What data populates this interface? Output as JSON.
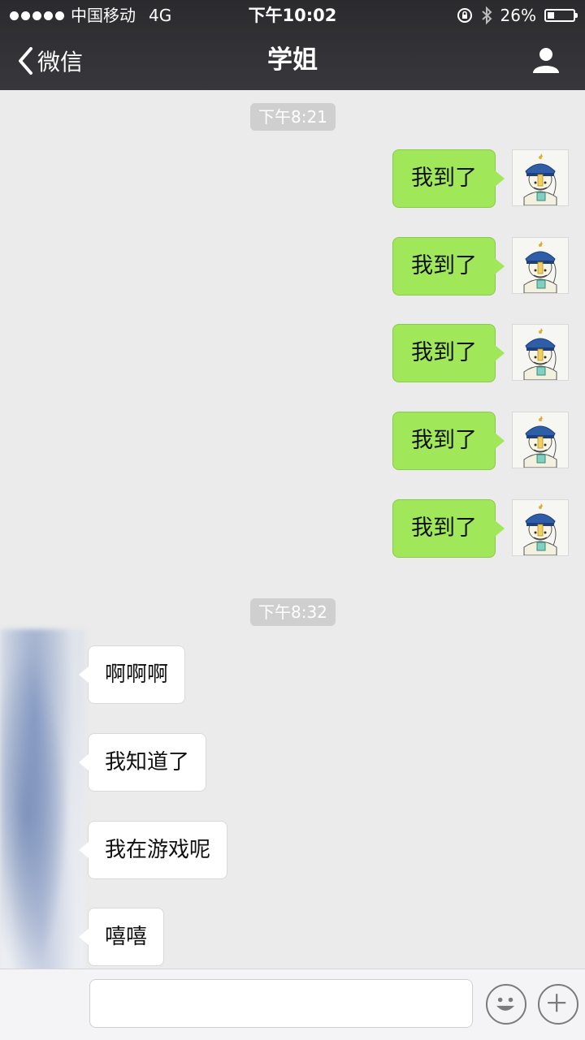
{
  "status_bar": {
    "carrier": "中国移动",
    "network": "4G",
    "time": "下午10:02",
    "battery": "26%",
    "battery_level": 0.26
  },
  "nav": {
    "back_label": "微信",
    "title": "学姐"
  },
  "timestamps": [
    "下午8:21",
    "下午8:32"
  ],
  "outgoing_messages": [
    "我到了",
    "我到了",
    "我到了",
    "我到了",
    "我到了"
  ],
  "incoming_messages": [
    "啊啊啊",
    "我知道了",
    "我在游戏呢",
    "嘻嘻"
  ],
  "icons": {
    "back": "chevron-left-icon",
    "profile": "person-icon",
    "emoji": "smiley-icon",
    "more": "plus-icon",
    "lock": "rotation-lock-icon",
    "bluetooth": "bluetooth-icon"
  }
}
